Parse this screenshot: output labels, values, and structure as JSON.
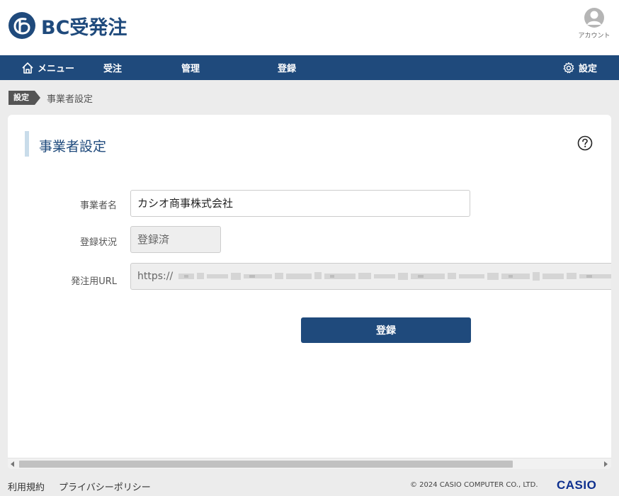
{
  "app": {
    "logo_text": "BC受発注",
    "account_label": "アカウント"
  },
  "nav": {
    "menu_label": "メニュー",
    "items": [
      "受注",
      "管理",
      "登録"
    ],
    "settings_label": "設定"
  },
  "breadcrumb": {
    "tag": "設定",
    "current": "事業者設定"
  },
  "page": {
    "title": "事業者設定"
  },
  "form": {
    "business_name_label": "事業者名",
    "business_name_value": "カシオ商事株式会社",
    "status_label": "登録状況",
    "status_value": "登録済",
    "url_label": "発注用URL",
    "url_value": "https://"
  },
  "actions": {
    "submit_label": "登録"
  },
  "footer": {
    "terms": "利用規約",
    "privacy": "プライバシーポリシー",
    "copyright": "© 2024 CASIO COMPUTER CO., LTD.",
    "brand": "CASIO"
  },
  "colors": {
    "primary": "#1f4a7c",
    "accent_bar": "#c9dcea",
    "brand_blue": "#0d2f8e"
  },
  "icons": {
    "home": "home-icon",
    "settings": "gear-icon",
    "account": "user-icon",
    "help": "help-icon"
  }
}
